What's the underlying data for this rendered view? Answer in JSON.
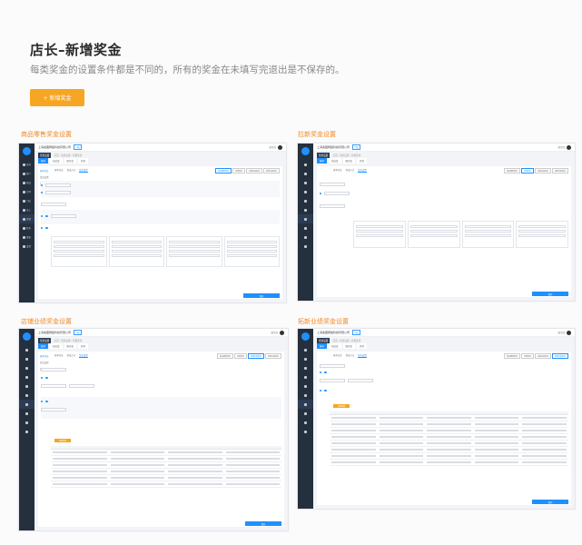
{
  "header": {
    "title": "店长–新增奖金",
    "subtitle": "每类奖金的设置条件都是不同的，所有的奖金在未填写完退出是不保存的。",
    "add_button": "+ 新增奖金"
  },
  "colors": {
    "accent": "#f6a623",
    "section_title": "#f08a24",
    "primary": "#1e90ff",
    "sidebar": "#25303e"
  },
  "sections": [
    {
      "label": "商品零售奖金设置"
    },
    {
      "label": "拉新奖金设置"
    },
    {
      "label": "店铺业绩奖金设置"
    },
    {
      "label": "拓新业绩奖金设置"
    }
  ],
  "app": {
    "company": "上海奥图网络科技有限公司",
    "tag": "门店",
    "user": "周主任",
    "crumb_first": "奖金设置",
    "crumb_path": "首页 / 奖金设置 / 新增奖金",
    "tabs": [
      "基本",
      "商品奖",
      "服务奖",
      "其他"
    ],
    "left_links": [
      "基本信息",
      "奖金设置",
      "奖金方案"
    ],
    "subtabs": [
      "基本信息",
      "提成方式",
      "奖金设置"
    ],
    "right_tabs": [
      "商品零售奖金",
      "拉新奖金",
      "店铺业绩奖金",
      "拓新业绩奖金"
    ],
    "save_label": "保存",
    "orange_small": "添加阶梯",
    "sidebar_items": [
      "首页",
      "客户",
      "商品",
      "订单",
      "门店",
      "员工",
      "营销",
      "财务",
      "报表",
      "设置",
      "消息",
      "帮助"
    ]
  }
}
